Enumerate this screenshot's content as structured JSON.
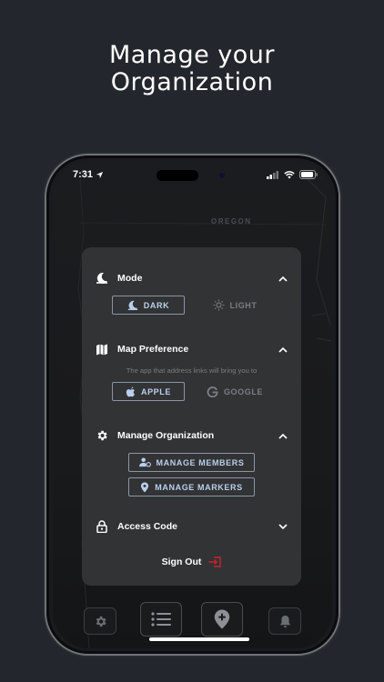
{
  "headline": {
    "line1": "Manage your",
    "line2": "Organization"
  },
  "status_bar": {
    "time": "7:31"
  },
  "map": {
    "region_label": "OREGON"
  },
  "settings": {
    "mode": {
      "title": "Mode",
      "options": [
        {
          "label": "DARK",
          "selected": true,
          "icon": "moon-icon"
        },
        {
          "label": "LIGHT",
          "selected": false,
          "icon": "sun-icon"
        }
      ]
    },
    "map_preference": {
      "title": "Map Preference",
      "hint": "The app that address links will bring you to",
      "options": [
        {
          "label": "APPLE",
          "selected": true,
          "icon": "apple-icon"
        },
        {
          "label": "GOOGLE",
          "selected": false,
          "icon": "google-icon"
        }
      ]
    },
    "manage_org": {
      "title": "Manage Organization",
      "buttons": [
        {
          "label": "MANAGE MEMBERS",
          "icon": "members-icon"
        },
        {
          "label": "MANAGE MARKERS",
          "icon": "map-pin-icon"
        }
      ]
    },
    "access_code": {
      "title": "Access Code"
    },
    "sign_out": {
      "label": "Sign Out"
    }
  },
  "colors": {
    "background": "#23262c",
    "panel": "#323335",
    "accent_text": "#b9d0ec",
    "sign_out_icon": "#d0202a"
  },
  "tab_bar": {
    "tabs": [
      "settings-icon",
      "list-icon",
      "add-marker-icon",
      "bell-icon"
    ]
  }
}
